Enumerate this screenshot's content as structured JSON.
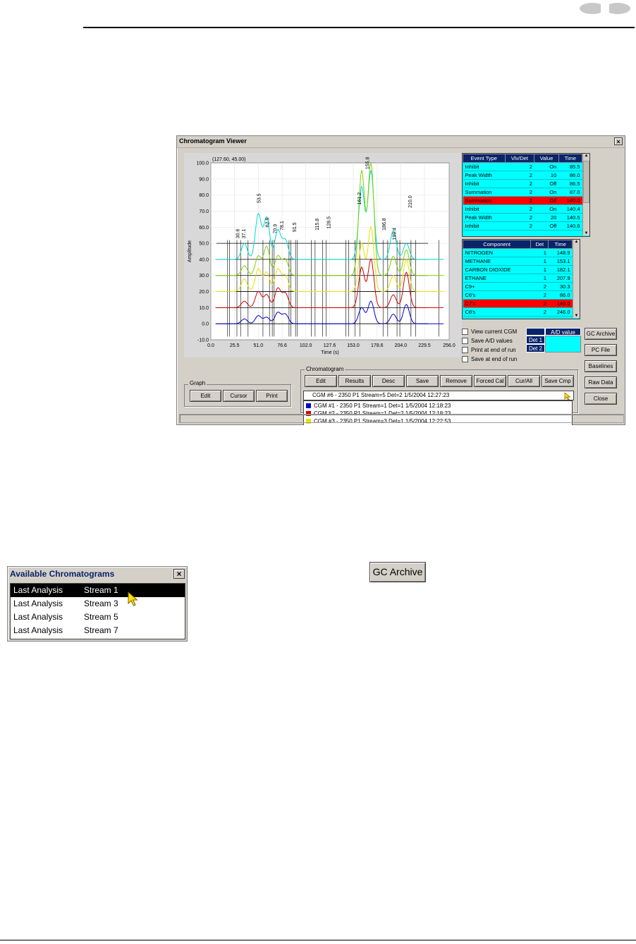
{
  "window": {
    "title": "Chromatogram Viewer",
    "close_glyph": "×"
  },
  "chart_data": {
    "type": "line",
    "title": "",
    "cursor_readout": "(127.60, 45.00)",
    "xlabel": "Time (s)",
    "ylabel": "Amplitude",
    "xlim": [
      0,
      256
    ],
    "ylim": [
      -10,
      100
    ],
    "x_ticks": [
      "0.0",
      "25.5",
      "51.0",
      "76.6",
      "102.0",
      "127.6",
      "153.0",
      "178.6",
      "204.0",
      "229.5",
      "256.0"
    ],
    "y_ticks": [
      "100.0",
      "90.0",
      "80.0",
      "70.0",
      "60.0",
      "50.0",
      "40.0",
      "30.0",
      "20.0",
      "10.0",
      "0.0",
      "-10.0"
    ],
    "grid": true,
    "series": [
      {
        "color": "#00d8d8",
        "baseline": 40,
        "peaks": [
          [
            36,
            10
          ],
          [
            51,
            28
          ],
          [
            60,
            26
          ],
          [
            72,
            18
          ],
          [
            80,
            12
          ],
          [
            162,
            45
          ],
          [
            172,
            55
          ],
          [
            196,
            18
          ],
          [
            210,
            10
          ]
        ]
      },
      {
        "color": "#7cd400",
        "baseline": 30,
        "peaks": [
          [
            36,
            6
          ],
          [
            51,
            12
          ],
          [
            60,
            18
          ],
          [
            72,
            12
          ],
          [
            80,
            10
          ],
          [
            162,
            65
          ],
          [
            172,
            70
          ],
          [
            196,
            12
          ],
          [
            210,
            16
          ]
        ]
      },
      {
        "color": "#e8e000",
        "baseline": 20,
        "peaks": [
          [
            36,
            8
          ],
          [
            51,
            14
          ],
          [
            60,
            12
          ],
          [
            72,
            14
          ],
          [
            80,
            10
          ],
          [
            162,
            30
          ],
          [
            172,
            40
          ],
          [
            196,
            10
          ],
          [
            210,
            20
          ]
        ]
      },
      {
        "color": "#d00000",
        "baseline": 10,
        "peaks": [
          [
            36,
            4
          ],
          [
            51,
            10
          ],
          [
            60,
            8
          ],
          [
            72,
            12
          ],
          [
            80,
            9
          ],
          [
            162,
            25
          ],
          [
            172,
            30
          ],
          [
            196,
            8
          ],
          [
            210,
            22
          ]
        ]
      },
      {
        "color": "#0000cc",
        "baseline": 0,
        "peaks": [
          [
            36,
            3
          ],
          [
            51,
            5
          ],
          [
            60,
            4
          ],
          [
            72,
            7
          ],
          [
            80,
            6
          ],
          [
            162,
            10
          ],
          [
            172,
            14
          ],
          [
            196,
            6
          ],
          [
            210,
            12
          ]
        ]
      }
    ],
    "peak_labels": [
      {
        "x": 30.6,
        "y": 53,
        "text": "30.6"
      },
      {
        "x": 37.1,
        "y": 53,
        "text": "37.1"
      },
      {
        "x": 53.5,
        "y": 75,
        "text": "53.5"
      },
      {
        "x": 62.5,
        "y": 60,
        "text": "62.5"
      },
      {
        "x": 70.9,
        "y": 56,
        "text": "70.9"
      },
      {
        "x": 78.1,
        "y": 58,
        "text": "78.1"
      },
      {
        "x": 91.5,
        "y": 57,
        "text": "91.5"
      },
      {
        "x": 115.8,
        "y": 58,
        "text": "115.8"
      },
      {
        "x": 128.5,
        "y": 59,
        "text": "128.5"
      },
      {
        "x": 161.2,
        "y": 74,
        "text": "161.2"
      },
      {
        "x": 169.9,
        "y": 96,
        "text": "155.8"
      },
      {
        "x": 188,
        "y": 58,
        "text": "186.8"
      },
      {
        "x": 199,
        "y": 52,
        "text": "199.4"
      },
      {
        "x": 216,
        "y": 72,
        "text": "210.0"
      }
    ]
  },
  "event_table": {
    "headers": [
      "Event Type",
      "Vlv/Det",
      "Value",
      "Time"
    ],
    "rows": [
      [
        "Inhibit",
        "2",
        "On",
        "85.5"
      ],
      [
        "Peak Width",
        "2",
        "10",
        "86.0"
      ],
      [
        "Inhibit",
        "2",
        "Off",
        "86.5"
      ],
      [
        "Summation",
        "2",
        "On",
        "87.0"
      ],
      [
        "Summation",
        "2",
        "Off",
        "140.0"
      ],
      [
        "Inhibit",
        "2",
        "On",
        "140.4"
      ],
      [
        "Peak Width",
        "2",
        "20",
        "140.5"
      ],
      [
        "Inhibit",
        "2",
        "Off",
        "140.6"
      ]
    ],
    "selected_index": 4
  },
  "component_table": {
    "headers": [
      "Component",
      "Det",
      "Time"
    ],
    "rows": [
      [
        "NITROGEN",
        "1",
        "148.9"
      ],
      [
        "METHANE",
        "1",
        "153.1"
      ],
      [
        "CARBON DIOXIDE",
        "1",
        "182.1"
      ],
      [
        "ETHANE",
        "1",
        "207.9"
      ],
      [
        "C9+",
        "2",
        "30.3"
      ],
      [
        "C6's",
        "2",
        "86.0"
      ],
      [
        "C7's",
        "2",
        "140.0"
      ],
      [
        "C8's",
        "2",
        "246.0"
      ]
    ],
    "selected_index": 6
  },
  "checkboxes": [
    "View current CGM",
    "Save A/D values",
    "Print at end of run",
    "Save at end of run"
  ],
  "ad_box": {
    "header": "A/D value",
    "det1": "Det 1",
    "det2": "Det 2"
  },
  "side_buttons": [
    "GC Archive",
    "PC File",
    "Baselines",
    "Raw Data",
    "Close"
  ],
  "graph_group": {
    "label": "Graph",
    "buttons": [
      "Edit",
      "Cursor",
      "Print"
    ]
  },
  "chromatogram_group": {
    "label": "Chromatogram",
    "buttons": [
      "Edit",
      "Results",
      "Desc",
      "Save",
      "Remove",
      "Forced Cal",
      "Cur/All",
      "Save Cmp"
    ],
    "selected": "CGM #6 - 2350 P1 Stream=5 Det=2 1/5/2004 12:27:23",
    "list": [
      {
        "color": "#0000cc",
        "text": "CGM #1 - 2350 P1 Stream=1 Det=1 1/5/2004 12:18:23"
      },
      {
        "color": "#d00000",
        "text": "CGM #2 - 2350 P1 Stream=1 Det=2 1/5/2004 12:18:23"
      },
      {
        "color": "#e8e000",
        "text": "CGM #3 - 2350 P1 Stream=3 Det=1 1/5/2004 12:22:53"
      }
    ]
  },
  "available": {
    "title": "Available Chromatograms",
    "close_glyph": "×",
    "rows": [
      [
        "Last Analysis",
        "Stream 1"
      ],
      [
        "Last Analysis",
        "Stream 3"
      ],
      [
        "Last Analysis",
        "Stream 5"
      ],
      [
        "Last Analysis",
        "Stream 7"
      ]
    ],
    "selected_index": 0
  },
  "gc_archive_button": "GC Archive"
}
